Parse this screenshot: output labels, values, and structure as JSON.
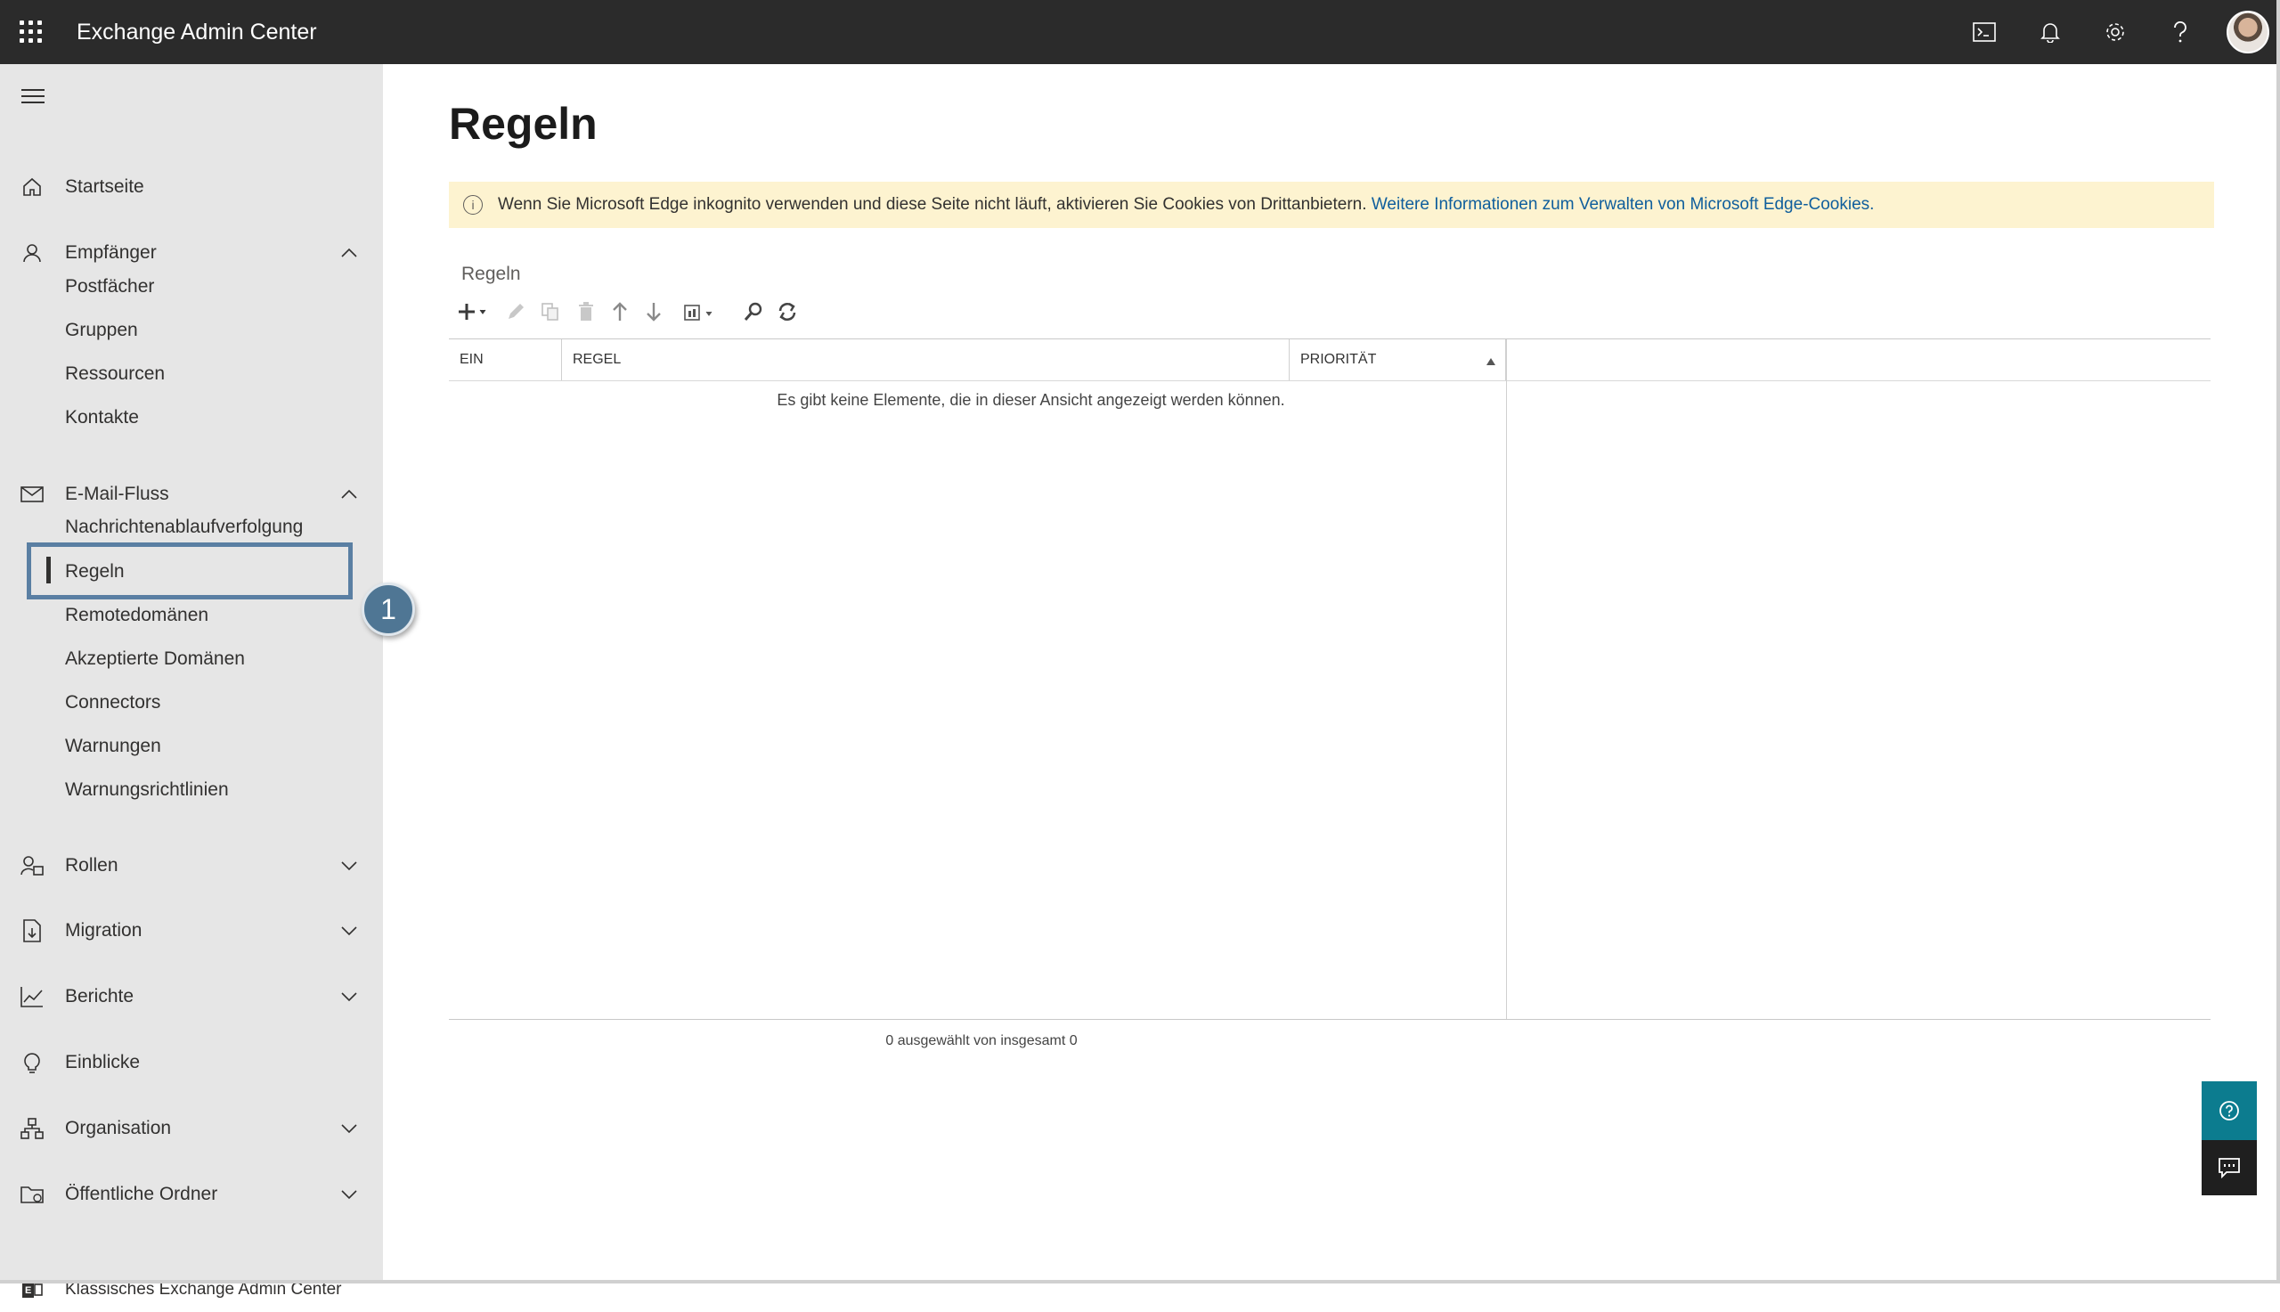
{
  "app": {
    "title": "Exchange Admin Center"
  },
  "topbar": {
    "icons": [
      "terminal-icon",
      "bell-icon",
      "gear-icon",
      "help-icon",
      "avatar"
    ]
  },
  "sidebar": {
    "home": "Startseite",
    "recipients": {
      "label": "Empfänger",
      "items": [
        "Postfächer",
        "Gruppen",
        "Ressourcen",
        "Kontakte"
      ]
    },
    "mailflow": {
      "label": "E-Mail-Fluss",
      "items": [
        "Nachrichtenablaufverfolgung",
        "Regeln",
        "Remotedomänen",
        "Akzeptierte Domänen",
        "Connectors",
        "Warnungen",
        "Warnungsrichtlinien"
      ],
      "selected": "Regeln"
    },
    "roles": "Rollen",
    "migration": "Migration",
    "reports": "Berichte",
    "insights": "Einblicke",
    "organization": "Organisation",
    "public_folders": "Öffentliche Ordner",
    "classic": "Klassisches Exchange Admin Center"
  },
  "callout": {
    "number": "1"
  },
  "main": {
    "title": "Regeln",
    "banner": {
      "text": "Wenn Sie Microsoft Edge inkognito verwenden und diese Seite nicht läuft, aktivieren Sie Cookies von Drittanbietern.",
      "link": "Weitere Informationen zum Verwalten von Microsoft Edge-Cookies."
    },
    "section_label": "Regeln",
    "table": {
      "columns": [
        "EIN",
        "REGEL",
        "PRIORITÄT"
      ],
      "empty_message": "Es gibt keine Elemente, die in dieser Ansicht angezeigt werden können."
    },
    "status": "0 ausgewählt von insgesamt 0"
  },
  "colors": {
    "topbar": "#2b2b2b",
    "sidebar": "#e6e6e6",
    "banner": "#fdf3d0",
    "accent": "#0c7c8f",
    "selection": "#5a7fa3"
  }
}
